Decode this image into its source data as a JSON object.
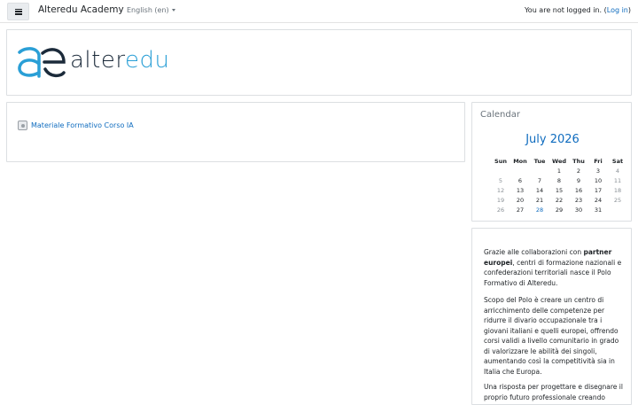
{
  "navbar": {
    "site_name": "Alteredu Academy",
    "language": "English (en)",
    "login_prefix": "You are not logged in. (",
    "login_link": "Log in",
    "login_suffix": ")"
  },
  "banner": {
    "logo_dark": "alter",
    "logo_light": "edu"
  },
  "main": {
    "course_link": "Materiale Formativo Corso IA"
  },
  "calendar": {
    "title": "Calendar",
    "month": "July 2026",
    "weekdays": [
      "Sun",
      "Mon",
      "Tue",
      "Wed",
      "Thu",
      "Fri",
      "Sat"
    ],
    "weeks": [
      [
        "",
        "",
        "",
        "1",
        "2",
        "3",
        "4"
      ],
      [
        "5",
        "6",
        "7",
        "8",
        "9",
        "10",
        "11"
      ],
      [
        "12",
        "13",
        "14",
        "15",
        "16",
        "17",
        "18"
      ],
      [
        "19",
        "20",
        "21",
        "22",
        "23",
        "24",
        "25"
      ],
      [
        "26",
        "27",
        "28",
        "29",
        "30",
        "31",
        ""
      ]
    ],
    "today": "28"
  },
  "info": {
    "p1_a": "Grazie alle collaborazioni con ",
    "p1_bold": "partner europei",
    "p1_b": ", centri di formazione nazionali e confederazioni territoriali nasce il Polo Formativo di Alteredu.",
    "p2": "Scopo del Polo è creare un centro di arricchimento delle competenze per ridurre il divario occupazionale tra i giovani italiani e quelli europei, offrendo corsi validi a livello comunitario in grado di valorizzare le abilità dei singoli, aumentando così la competitività sia in Italia che Europa.",
    "p3": "Una risposta per progettare e disegnare il proprio futuro professionale creando"
  },
  "colors": {
    "link": "#0f6cbf",
    "logo_dark": "#1b2a3a",
    "logo_light": "#2a9fd6"
  }
}
